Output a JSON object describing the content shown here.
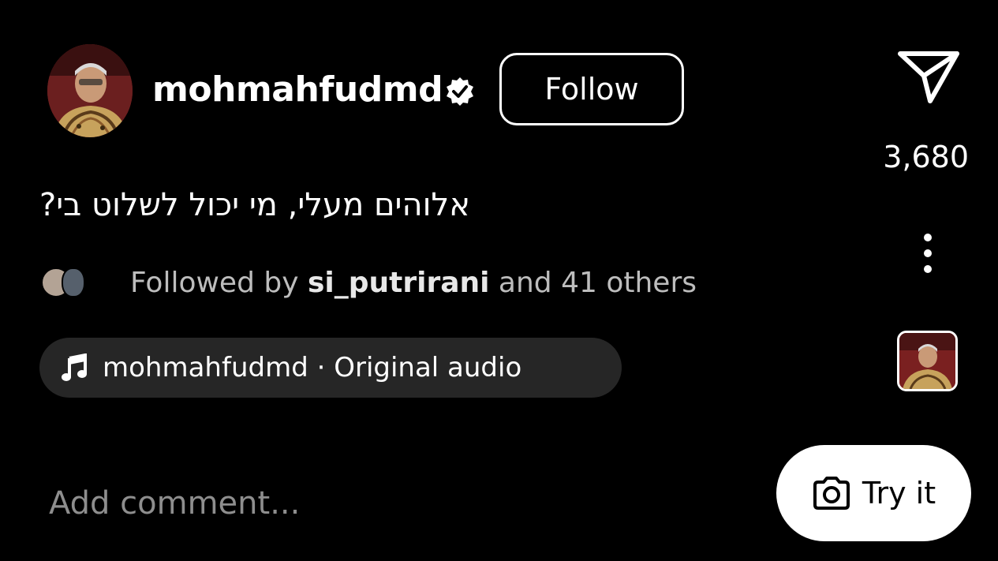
{
  "post": {
    "username": "mohmahfudmd",
    "follow_label": "Follow",
    "caption": "אלוהים מעלי, מי יכול לשלוט בי?",
    "followed_by": {
      "prefix": "Followed by",
      "name": "si_putrirani",
      "suffix": "and 41 others"
    }
  },
  "actions": {
    "share_count": "3,680"
  },
  "audio": {
    "label": "mohmahfudmd · Original audio"
  },
  "comment": {
    "placeholder": "Add comment..."
  },
  "try_button": {
    "label": "Try it"
  },
  "icons": {
    "verified": "verified-badge-icon",
    "send": "send-icon",
    "more": "more-vertical-icon",
    "music": "music-note-icon",
    "camera": "camera-icon"
  },
  "colors": {
    "background": "#000000",
    "text": "#ffffff",
    "muted_text": "#bdbdbd",
    "placeholder": "#8e8e8e",
    "pill_background": "#262626"
  }
}
